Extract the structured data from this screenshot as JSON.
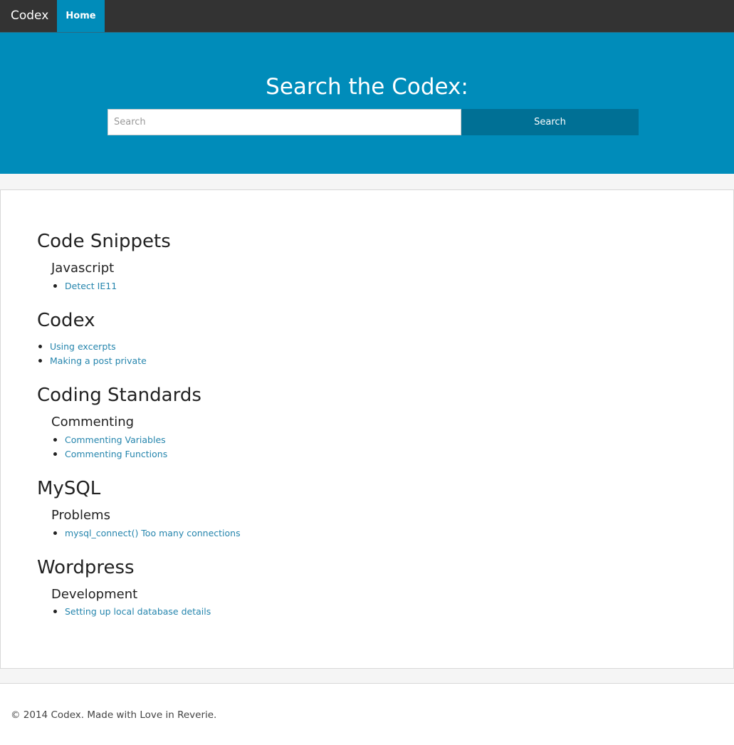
{
  "nav": {
    "brand": "Codex",
    "home": "Home"
  },
  "hero": {
    "title": "Search the Codex:",
    "search_placeholder": "Search",
    "search_value": "",
    "search_button": "Search"
  },
  "sections": [
    {
      "title": "Code Snippets",
      "subtitle": "Javascript",
      "items": [
        "Detect IE11"
      ]
    },
    {
      "title": "Codex",
      "subtitle": "",
      "items": [
        "Using excerpts",
        "Making a post private"
      ]
    },
    {
      "title": "Coding Standards",
      "subtitle": "Commenting",
      "items": [
        "Commenting Variables",
        "Commenting Functions"
      ]
    },
    {
      "title": "MySQL",
      "subtitle": "Problems",
      "items": [
        "mysql_connect() Too many connections"
      ]
    },
    {
      "title": "Wordpress",
      "subtitle": "Development",
      "items": [
        "Setting up local database details"
      ]
    }
  ],
  "footer": {
    "text": "© 2014 Codex. Made with Love in Reverie."
  },
  "colors": {
    "accent": "#008cba",
    "button": "#007095",
    "link": "#2585ad",
    "topbar": "#333333"
  }
}
